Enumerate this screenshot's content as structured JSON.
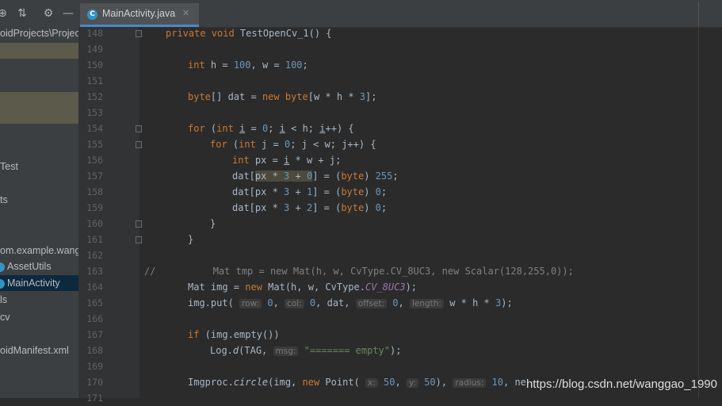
{
  "toolbar": {
    "icons": [
      "globe-target-icon",
      "collapse-icon",
      "gear-icon",
      "minimize-icon"
    ],
    "globe_glyph": "⊕",
    "collapse_glyph": "⇅",
    "gear_glyph": "⚙",
    "minimize_glyph": "—"
  },
  "tab": {
    "icon_letter": "C",
    "label": "MainActivity.java",
    "close_glyph": "✕"
  },
  "sidebar": {
    "items": [
      {
        "label": "oidProjects\\Projec"
      },
      {
        "label": "Test"
      },
      {
        "label": "ts"
      },
      {
        "label": "om.example.wang"
      },
      {
        "label": "AssetUtils"
      },
      {
        "label": "MainActivity"
      },
      {
        "label": "ls"
      },
      {
        "label": "cv"
      },
      {
        "label": "oidManifest.xml"
      }
    ]
  },
  "gutter": {
    "line_numbers": [
      "148",
      "149",
      "150",
      "151",
      "152",
      "153",
      "154",
      "155",
      "156",
      "157",
      "158",
      "159",
      "160",
      "161",
      "162",
      "163",
      "164",
      "165",
      "166",
      "167",
      "168",
      "169",
      "170",
      "171"
    ]
  },
  "code": {
    "l148": {
      "k1": "private void",
      "t": " TestOpenCv_1() {"
    },
    "l150": {
      "k": "int",
      "t1": " h = ",
      "n1": "100",
      "t2": ", w = ",
      "n2": "100",
      "t3": ";"
    },
    "l152": {
      "k1": "byte",
      "t1": "[] dat = ",
      "k2": "new",
      "k3": " byte",
      "t2": "[w * h * ",
      "n": "3",
      "t3": "];"
    },
    "l154": {
      "k1": "for",
      "t1": " (",
      "k2": "int",
      "t2": " ",
      "u1": "i",
      "t3": " = ",
      "n": "0",
      "t4": "; ",
      "u2": "i",
      "t5": " < h; ",
      "u3": "i",
      "t6": "++) {"
    },
    "l155": {
      "k1": "for",
      "t1": " (",
      "k2": "int",
      "t2": " j = ",
      "n": "0",
      "t3": "; j < w; j++) {"
    },
    "l156": {
      "k": "int",
      "t1": " px = ",
      "u": "i",
      "t2": " * w + j;"
    },
    "l157": {
      "t1": "dat[",
      "m1": "px * ",
      "mn1": "3",
      "m2": " + ",
      "mn2": "0",
      "t2": "] = (",
      "k": "byte",
      "t3": ") ",
      "n": "255",
      "t4": ";"
    },
    "l158": {
      "t1": "dat[px * ",
      "n1": "3",
      "t2": " + ",
      "n2": "1",
      "t3": "] = (",
      "k": "byte",
      "t4": ") ",
      "n3": "0",
      "t5": ";"
    },
    "l159": {
      "t1": "dat[px * ",
      "n1": "3",
      "t2": " + ",
      "n2": "2",
      "t3": "] = (",
      "k": "byte",
      "t4": ") ",
      "n3": "0",
      "t5": ";"
    },
    "l160": {
      "t": "}"
    },
    "l161": {
      "t": "}"
    },
    "l163": {
      "c": "//          Mat tmp = new Mat(h, w, CvType.CV_8UC3, new Scalar(128,255,0));"
    },
    "l164": {
      "t1": "Mat img = ",
      "k": "new",
      "t2": " Mat(h, w, CvType.",
      "st": "CV_8UC3",
      "t3": ");"
    },
    "l165": {
      "t1": "img.put(",
      "h1": "row:",
      "n1": "0",
      "t2": ",",
      "h2": "col:",
      "n2": "0",
      "t3": ", dat,",
      "h3": "offset:",
      "n3": "0",
      "t4": ",",
      "h4": "length:",
      "t5": "w * h * ",
      "n4": "3",
      "t6": ");"
    },
    "l167": {
      "k": "if",
      "t": " (img.empty())"
    },
    "l168": {
      "t1": "Log.",
      "fi": "d",
      "t2": "(TAG,",
      "h": "msg:",
      "s": "\"======= empty\"",
      "t3": ");"
    },
    "l170": {
      "t1": "Imgproc.",
      "fi": "circle",
      "t2": "(img, ",
      "k": "new",
      "t3": " Point(",
      "h1": "x:",
      "n1": "50",
      "t4": ",",
      "h2": "y:",
      "n2": "50",
      "t5": "),",
      "h3": "radius:",
      "n3": "10",
      "t6": ", ne"
    }
  },
  "watermark": {
    "text": "https://blog.csdn.net/wanggao_1990"
  },
  "colors": {
    "keyword": "#CC7832",
    "number": "#6897BB",
    "string": "#6A8759",
    "comment": "#808080",
    "background": "#2B2B2B"
  }
}
